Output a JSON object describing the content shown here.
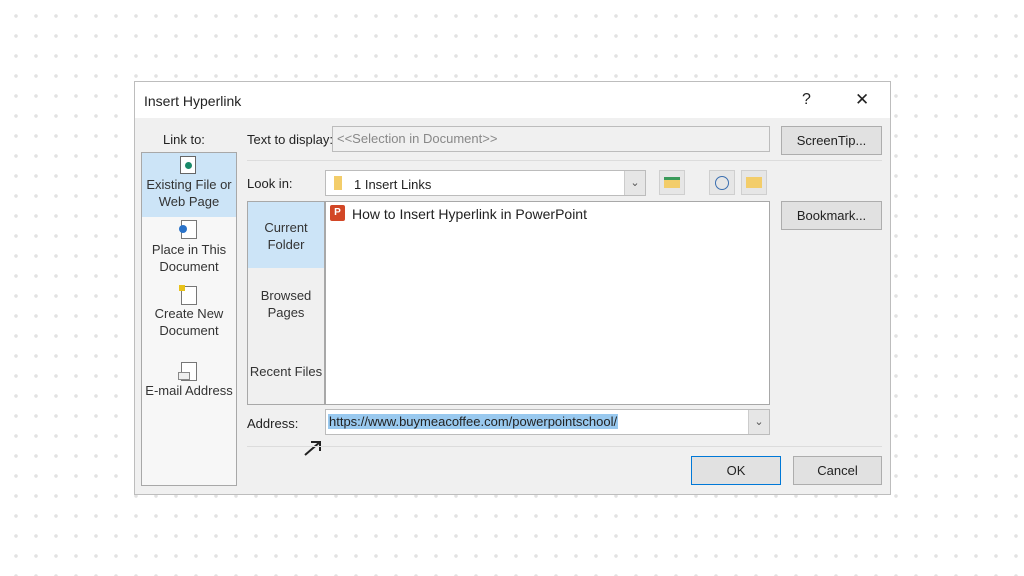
{
  "dialog": {
    "title": "Insert Hyperlink",
    "help": "?",
    "close": "✕"
  },
  "link_to": {
    "label": "Link to:",
    "items": [
      {
        "l1": "Existing File or",
        "l2": "Web Page",
        "icon": "existing-file-icon",
        "selected": true
      },
      {
        "l1": "Place in This",
        "l2": "Document",
        "icon": "place-in-document-icon"
      },
      {
        "l1": "Create New",
        "l2": "Document",
        "icon": "new-document-icon"
      },
      {
        "l1": "E-mail Address",
        "l2": "",
        "icon": "email-icon"
      }
    ]
  },
  "text_to_display": {
    "label": "Text to display:",
    "value": "<<Selection in Document>>"
  },
  "screentip": "ScreenTip...",
  "look_in": {
    "label": "Look in:",
    "value": "1 Insert Links"
  },
  "bookmark": "Bookmark...",
  "side_tabs": [
    {
      "l1": "Current",
      "l2": "Folder",
      "selected": true
    },
    {
      "l1": "Browsed",
      "l2": "Pages"
    },
    {
      "l1": "Recent Files",
      "l2": ""
    }
  ],
  "files": [
    {
      "name": "How to Insert Hyperlink in PowerPoint",
      "icon": "powerpoint-file-icon"
    }
  ],
  "address": {
    "label": "Address:",
    "value": "https://www.buymeacoffee.com/powerpointschool/"
  },
  "ok": "OK",
  "cancel": "Cancel",
  "colors": {
    "selected": "#cce4f7",
    "highlight": "#99c9ef",
    "ok_border": "#0078d7"
  }
}
